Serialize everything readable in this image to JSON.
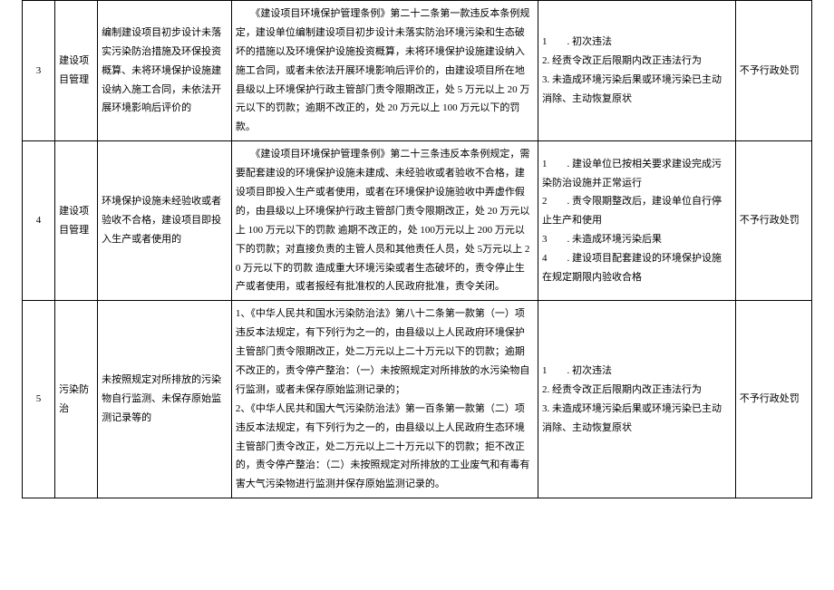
{
  "rows": [
    {
      "num": "3",
      "category": "建设项目管理",
      "act": "编制建设项目初步设计未落实污染防治措施及环保投资概算、未将环境保护设施建设纳入施工合同，未依法开展环境影响后评价的",
      "law": "　　《建设项目环境保护管理条例》第二十二条第一款违反本条例规定，建设单位编制建设项目初步设计未落实防治环境污染和生态破坏的措施以及环境保护设施投资概算，未将环境保护设施建设纳入施工合同，或者未依法开展环境影响后评价的，由建设项目所在地县级以上环境保护行政主管部门责令限期改正，处 5 万元以上 20 万元以下的罚款；逾期不改正的，处 20 万元以上 100 万元以下的罚款。",
      "cond": "1　　. 初次违法\n2. 经责令改正后限期内改正违法行为\n3. 未造成环境污染后果或环境污染已主动消除、主动恢复原状",
      "result": "不予行政处罚"
    },
    {
      "num": "4",
      "category": "建设项目管理",
      "act": "环境保护设施未经验收或者验收不合格，建设项目即投入生产或者使用的",
      "law": "　　《建设项目环境保护管理条例》第二十三条违反本条例规定，需要配套建设的环境保护设施未建成、未经验收或者验收不合格，建设项目即投入生产或者使用，或者在环境保护设施验收中弄虚作假的，由县级以上环境保护行政主管部门责令限期改正，处 20 万元以上 100 万元以下的罚款 逾期不改正的，处 100万元以上 200 万元以下的罚款；对直接负责的主管人员和其他责任人员，处 5万元以上 20 万元以下的罚款 造成重大环境污染或者生态破坏的，责令停止生产或者使用，或者报经有批准权的人民政府批准，责令关闭。",
      "cond": "1　　. 建设单位已按相关要求建设完成污染防治设施并正常运行\n2　　. 责令限期整改后，建设单位自行停止生产和使用\n3　　. 未造成环境污染后果\n4　　. 建设项目配套建设的环境保护设施在规定期限内验收合格",
      "result": "不予行政处罚"
    },
    {
      "num": "5",
      "category": "污染防治",
      "act": "未按照规定对所排放的污染物自行监测、未保存原始监测记录等的",
      "law": "1、《中华人民共和国水污染防治法》第八十二条第一款第（一）项违反本法规定，有下列行为之一的，由县级以上人民政府环境保护主管部门责令限期改正，处二万元以上二十万元以下的罚款；逾期不改正的，责令停产整治：（一）未按照规定对所排放的水污染物自行监测，或者未保存原始监测记录的；\n2、《中华人民共和国大气污染防治法》第一百条第一款第（二）项违反本法规定，有下列行为之一的，由县级以上人民政府生态环境主管部门责令改正，处二万元以上二十万元以下的罚款；拒不改正的，责令停产整治：（二）未按照规定对所排放的工业废气和有毒有害大气污染物进行监测并保存原始监测记录的。",
      "cond": "1　　. 初次违法\n2. 经责令改正后限期内改正违法行为\n3. 未造成环境污染后果或环境污染已主动消除、主动恢复原状",
      "result": "不予行政处罚"
    }
  ]
}
